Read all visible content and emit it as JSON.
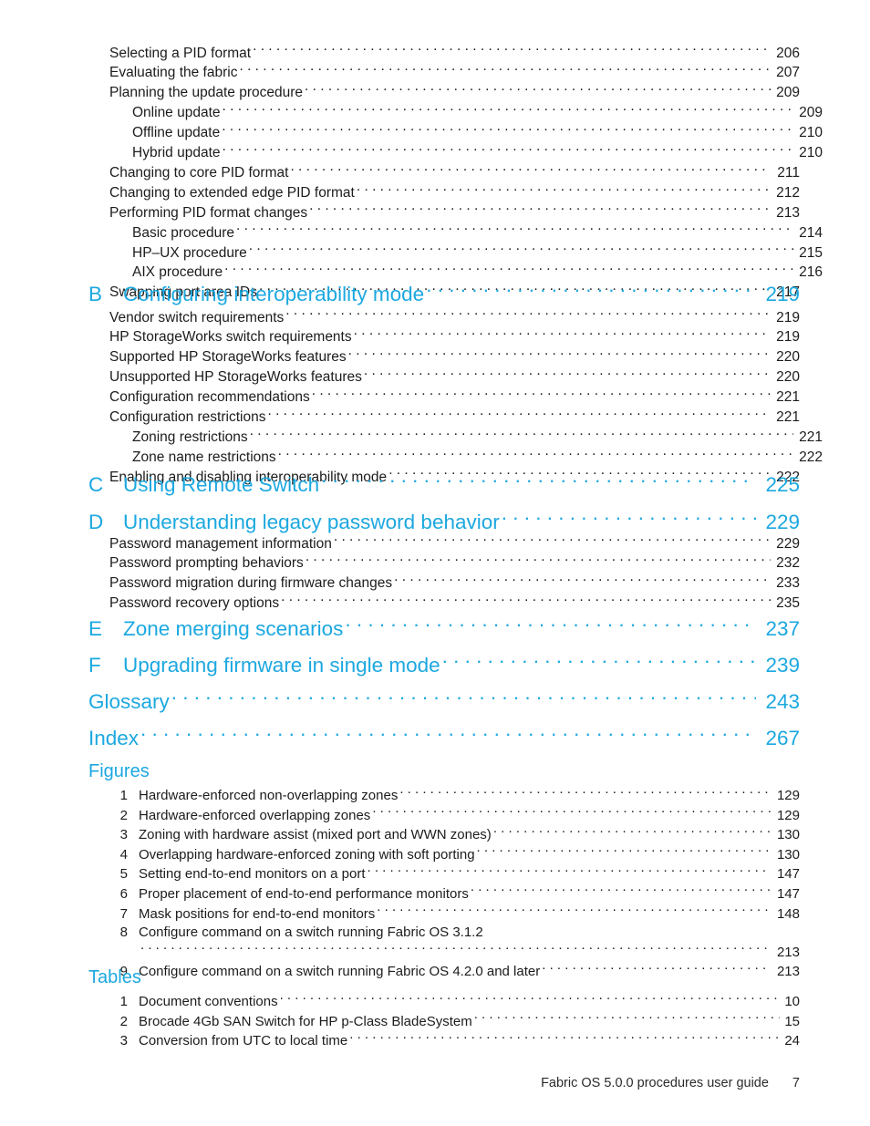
{
  "colors": {
    "heading_cyan": "#1CA8E0",
    "body_text": "#1c1c1c",
    "page_background": "#ffffff"
  },
  "toc_group_1": {
    "entries": [
      {
        "label": "Selecting a PID format",
        "page": "206",
        "level": 1
      },
      {
        "label": "Evaluating the fabric",
        "page": "207",
        "level": 1
      },
      {
        "label": "Planning the update procedure",
        "page": "209",
        "level": 1
      },
      {
        "label": "Online update",
        "page": "209",
        "level": 2
      },
      {
        "label": "Offline update",
        "page": "210",
        "level": 2
      },
      {
        "label": "Hybrid update",
        "page": "210",
        "level": 2
      },
      {
        "label": "Changing to core PID format",
        "page": "211",
        "level": 1
      },
      {
        "label": "Changing to extended edge PID format",
        "page": "212",
        "level": 1
      },
      {
        "label": "Performing PID format changes",
        "page": "213",
        "level": 1
      },
      {
        "label": "Basic procedure",
        "page": "214",
        "level": 2
      },
      {
        "label": "HP–UX procedure",
        "page": "215",
        "level": 2
      },
      {
        "label": "AIX procedure",
        "page": "216",
        "level": 2
      },
      {
        "label": "Swapping port area IDs",
        "page": "217",
        "level": 1
      }
    ]
  },
  "chapter_b": {
    "letter": "B",
    "title": "Configuring interoperability mode",
    "page": "219"
  },
  "toc_group_2": {
    "entries": [
      {
        "label": "Vendor switch requirements",
        "page": "219",
        "level": 1
      },
      {
        "label": "HP StorageWorks switch requirements",
        "page": "219",
        "level": 1
      },
      {
        "label": "Supported HP StorageWorks features",
        "page": "220",
        "level": 1
      },
      {
        "label": "Unsupported HP StorageWorks features",
        "page": "220",
        "level": 1
      },
      {
        "label": "Configuration recommendations",
        "page": "221",
        "level": 1
      },
      {
        "label": "Configuration restrictions",
        "page": "221",
        "level": 1
      },
      {
        "label": "Zoning restrictions",
        "page": "221",
        "level": 2
      },
      {
        "label": "Zone name restrictions",
        "page": "222",
        "level": 2
      },
      {
        "label": "Enabling and disabling interoperability mode",
        "page": "222",
        "level": 1
      }
    ]
  },
  "chapter_c": {
    "letter": "C",
    "title": "Using Remote Switch",
    "page": "225"
  },
  "chapter_d": {
    "letter": "D",
    "title": "Understanding legacy password behavior",
    "page": "229"
  },
  "toc_group_3": {
    "entries": [
      {
        "label": "Password management information",
        "page": "229",
        "level": 1
      },
      {
        "label": "Password prompting behaviors",
        "page": "232",
        "level": 1
      },
      {
        "label": "Password migration during firmware changes",
        "page": "233",
        "level": 1
      },
      {
        "label": "Password recovery options",
        "page": "235",
        "level": 1
      }
    ]
  },
  "chapter_e": {
    "letter": "E",
    "title": "Zone merging scenarios",
    "page": "237"
  },
  "chapter_f": {
    "letter": "F",
    "title": "Upgrading firmware in single mode",
    "page": "239"
  },
  "glossary": {
    "letter": "",
    "title": "Glossary",
    "page": "243"
  },
  "index": {
    "letter": "",
    "title": "Index",
    "page": "267"
  },
  "figures": {
    "heading": "Figures",
    "items": [
      {
        "num": "1",
        "label": "Hardware-enforced non-overlapping zones",
        "page": "129"
      },
      {
        "num": "2",
        "label": "Hardware-enforced overlapping zones",
        "page": "129"
      },
      {
        "num": "3",
        "label": "Zoning with hardware assist (mixed port and WWN zones)",
        "page": "130"
      },
      {
        "num": "4",
        "label": "Overlapping hardware-enforced zoning with soft porting",
        "page": "130"
      },
      {
        "num": "5",
        "label": "Setting end-to-end monitors on a port",
        "page": "147"
      },
      {
        "num": "6",
        "label": "Proper placement of end-to-end performance monitors",
        "page": "147"
      },
      {
        "num": "7",
        "label": "Mask positions for end-to-end monitors",
        "page": "148"
      },
      {
        "num": "8",
        "label": "Configure command on a switch running Fabric OS 3.1.2",
        "page": "213"
      },
      {
        "num": "9",
        "label": "Configure command on a switch running Fabric OS 4.2.0 and later",
        "page": "213"
      }
    ]
  },
  "tables": {
    "heading": "Tables",
    "items": [
      {
        "num": "1",
        "label": "Document conventions",
        "page": "10"
      },
      {
        "num": "2",
        "label": "Brocade 4Gb SAN Switch for HP p-Class BladeSystem",
        "page": "15"
      },
      {
        "num": "3",
        "label": "Conversion from UTC to local time",
        "page": "24"
      }
    ]
  },
  "footer": {
    "title": "Fabric OS 5.0.0 procedures user guide",
    "page": "7"
  }
}
